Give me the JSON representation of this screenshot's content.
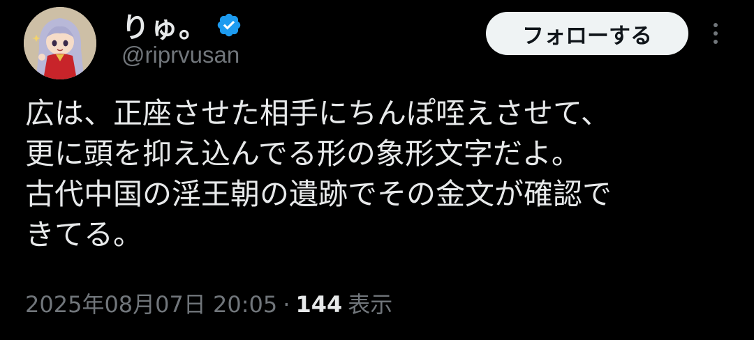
{
  "tweet": {
    "author": {
      "display_name": "りゅ。",
      "handle": "@riprvusan",
      "verified": true,
      "verified_color": "#1d9bf0"
    },
    "follow_label": "フォローする",
    "more_icon": "more-vertical-icon",
    "text_lines": [
      "広は、正座させた相手にちんぽ咥えさせて、",
      "更に頭を抑え込んでる形の象形文字だよ。",
      "古代中国の淫王朝の遺跡でその金文が確認で",
      "きてる。"
    ],
    "timestamp": "2025年08月07日 20:05",
    "separator": "·",
    "views_count": "144",
    "views_label": "表示"
  },
  "colors": {
    "background": "#000000",
    "primary_text": "#e7e9ea",
    "secondary_text": "#71767b",
    "button_bg": "#eff3f4",
    "button_text": "#0f1419"
  }
}
